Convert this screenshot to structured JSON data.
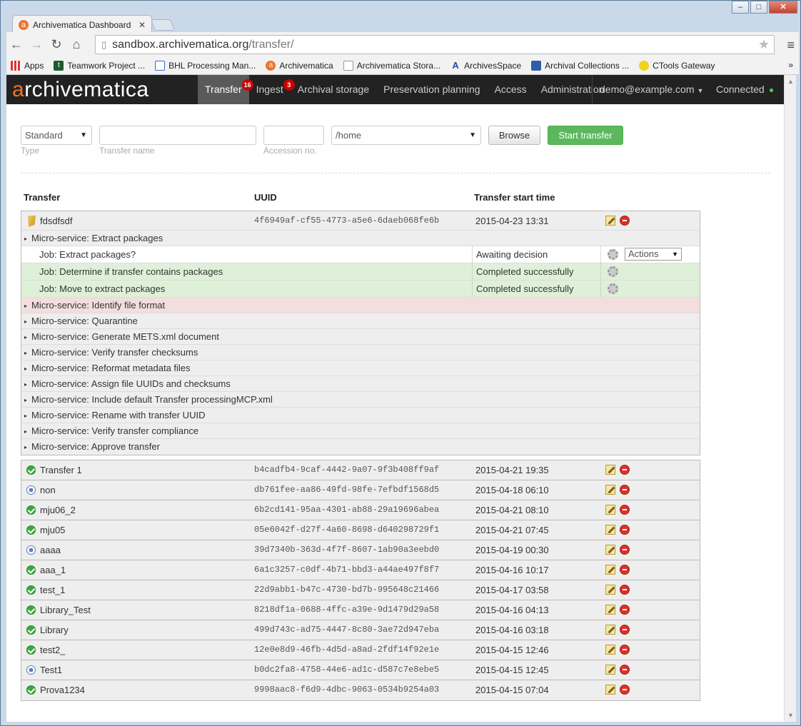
{
  "browser": {
    "tab_title": "Archivematica Dashboard",
    "url_host": "sandbox.archivematica.org",
    "url_path": "/transfer/",
    "bookmarks": [
      {
        "label": "Apps",
        "icon": "apps-grid-icon"
      },
      {
        "label": "Teamwork Project ...",
        "icon": "teamwork-icon"
      },
      {
        "label": "BHL Processing Man...",
        "icon": "document-icon"
      },
      {
        "label": "Archivematica",
        "icon": "archivematica-icon"
      },
      {
        "label": "Archivematica Stora...",
        "icon": "page-icon"
      },
      {
        "label": "ArchivesSpace",
        "icon": "archivesspace-icon"
      },
      {
        "label": "Archival Collections ...",
        "icon": "mail-icon"
      },
      {
        "label": "CTools Gateway",
        "icon": "ctools-icon"
      }
    ],
    "more": "»"
  },
  "app": {
    "logo_a": "a",
    "logo_rest": "rchivematica",
    "nav": [
      {
        "label": "Transfer",
        "badge": "16",
        "active": true
      },
      {
        "label": "Ingest",
        "badge": "3",
        "active": false
      },
      {
        "label": "Archival storage",
        "badge": "",
        "active": false
      },
      {
        "label": "Preservation planning",
        "badge": "",
        "active": false
      },
      {
        "label": "Access",
        "badge": "",
        "active": false
      },
      {
        "label": "Administration",
        "badge": "",
        "active": false
      }
    ],
    "user": "demo@example.com",
    "status": "Connected"
  },
  "form": {
    "type_value": "Standard",
    "type_label": "Type",
    "name_label": "Transfer name",
    "accession_label": "Accession no.",
    "path_value": "/home",
    "browse": "Browse",
    "start": "Start transfer"
  },
  "table": {
    "col_transfer": "Transfer",
    "col_uuid": "UUID",
    "col_start": "Transfer start time"
  },
  "expanded": {
    "name": "fdsdfsdf",
    "uuid": "4f6949af-cf55-4773-a5e6-6daeb068fe6b",
    "time": "2015-04-23 13:31",
    "first_ms": "Micro-service: Extract packages",
    "jobs": [
      {
        "name": "Job: Extract packages?",
        "status": "Awaiting decision",
        "state": "await",
        "actions": "Actions"
      },
      {
        "name": "Job: Determine if transfer contains packages",
        "status": "Completed successfully",
        "state": "done"
      },
      {
        "name": "Job: Move to extract packages",
        "status": "Completed successfully",
        "state": "done"
      }
    ],
    "microservices": [
      {
        "label": "Micro-service: Identify file format",
        "error": true
      },
      {
        "label": "Micro-service: Quarantine",
        "error": false
      },
      {
        "label": "Micro-service: Generate METS.xml document",
        "error": false
      },
      {
        "label": "Micro-service: Verify transfer checksums",
        "error": false
      },
      {
        "label": "Micro-service: Reformat metadata files",
        "error": false
      },
      {
        "label": "Micro-service: Assign file UUIDs and checksums",
        "error": false
      },
      {
        "label": "Micro-service: Include default Transfer processingMCP.xml",
        "error": false
      },
      {
        "label": "Micro-service: Rename with transfer UUID",
        "error": false
      },
      {
        "label": "Micro-service: Verify transfer compliance",
        "error": false
      },
      {
        "label": "Micro-service: Approve transfer",
        "error": false
      }
    ]
  },
  "transfers": [
    {
      "name": "Transfer 1",
      "uuid": "b4cadfb4-9caf-4442-9a07-9f3b408ff9af",
      "time": "2015-04-21 19:35",
      "status": "ok"
    },
    {
      "name": "non",
      "uuid": "db761fee-aa86-49fd-98fe-7efbdf1568d5",
      "time": "2015-04-18 06:10",
      "status": "pending"
    },
    {
      "name": "mju06_2",
      "uuid": "6b2cd141-95aa-4301-ab88-29a19696abea",
      "time": "2015-04-21 08:10",
      "status": "ok"
    },
    {
      "name": "mju05",
      "uuid": "05e6042f-d27f-4a60-8698-d640298729f1",
      "time": "2015-04-21 07:45",
      "status": "ok"
    },
    {
      "name": "aaaa",
      "uuid": "39d7340b-363d-4f7f-8607-1ab90a3eebd0",
      "time": "2015-04-19 00:30",
      "status": "pending"
    },
    {
      "name": "aaa_1",
      "uuid": "6a1c3257-c0df-4b71-bbd3-a44ae497f8f7",
      "time": "2015-04-16 10:17",
      "status": "ok"
    },
    {
      "name": "test_1",
      "uuid": "22d9abb1-b47c-4730-bd7b-995648c21466",
      "time": "2015-04-17 03:58",
      "status": "ok"
    },
    {
      "name": "Library_Test",
      "uuid": "8218df1a-0688-4ffc-a39e-9d1479d29a58",
      "time": "2015-04-16 04:13",
      "status": "ok"
    },
    {
      "name": "Library",
      "uuid": "499d743c-ad75-4447-8c80-3ae72d947eba",
      "time": "2015-04-16 03:18",
      "status": "ok"
    },
    {
      "name": "test2_",
      "uuid": "12e0e8d9-46fb-4d5d-a8ad-2fdf14f92e1e",
      "time": "2015-04-15 12:46",
      "status": "ok"
    },
    {
      "name": "Test1",
      "uuid": "b0dc2fa8-4758-44e6-ad1c-d587c7e8ebe5",
      "time": "2015-04-15 12:45",
      "status": "pending"
    },
    {
      "name": "Prova1234",
      "uuid": "9998aac8-f6d9-4dbc-9063-0534b9254a03",
      "time": "2015-04-15 07:04",
      "status": "ok"
    }
  ]
}
